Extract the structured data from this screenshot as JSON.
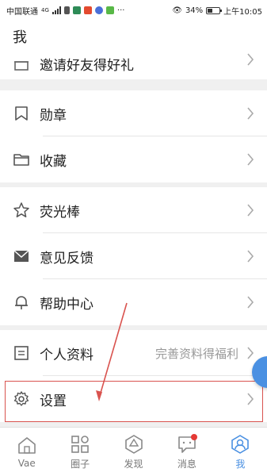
{
  "status_bar": {
    "carrier": "中国联通",
    "network": "4G",
    "battery": "34%",
    "time": "上午10:05"
  },
  "header": {
    "title": "我"
  },
  "menu": {
    "invite": "邀请好友得好礼",
    "badges": "勋章",
    "favorites": "收藏",
    "glowstick": "荧光棒",
    "feedback": "意见反馈",
    "help": "帮助中心",
    "profile": "个人资料",
    "profile_hint": "完善资料得福利",
    "settings": "设置"
  },
  "bottom_nav": [
    {
      "label": "Vae",
      "icon": "house-icon"
    },
    {
      "label": "圈子",
      "icon": "grid-icon"
    },
    {
      "label": "发现",
      "icon": "discover-icon"
    },
    {
      "label": "消息",
      "icon": "message-icon"
    },
    {
      "label": "我",
      "icon": "profile-icon"
    }
  ],
  "colors": {
    "accent": "#4a90e2",
    "highlight": "#d9534f",
    "badge": "#e53935"
  }
}
